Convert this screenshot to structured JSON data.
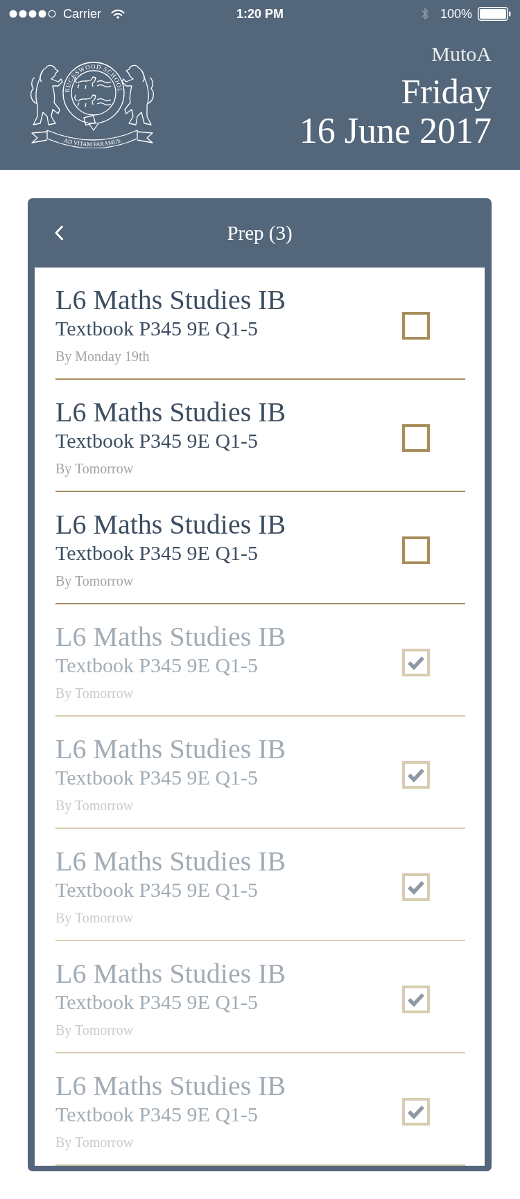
{
  "status_bar": {
    "carrier": "Carrier",
    "time": "1:20 PM",
    "battery": "100%"
  },
  "header": {
    "crest": {
      "ring_text": "BUCKSWOOD SCHOOL",
      "motto": "AD VITAM PARAMUS"
    },
    "user": "MutoA",
    "day": "Friday",
    "date": "16 June 2017"
  },
  "panel": {
    "title": "Prep (3)",
    "items": [
      {
        "subject": "L6 Maths Studies IB",
        "task": "Textbook P345 9E Q1-5",
        "due": "By Monday 19th",
        "checked": false
      },
      {
        "subject": "L6 Maths Studies IB",
        "task": "Textbook P345 9E Q1-5",
        "due": "By Tomorrow",
        "checked": false
      },
      {
        "subject": "L6 Maths Studies IB",
        "task": "Textbook P345 9E Q1-5",
        "due": "By Tomorrow",
        "checked": false
      },
      {
        "subject": "L6 Maths Studies IB",
        "task": "Textbook P345 9E Q1-5",
        "due": "By Tomorrow",
        "checked": true
      },
      {
        "subject": "L6 Maths Studies IB",
        "task": "Textbook P345 9E Q1-5",
        "due": "By Tomorrow",
        "checked": true
      },
      {
        "subject": "L6 Maths Studies IB",
        "task": "Textbook P345 9E Q1-5",
        "due": "By Tomorrow",
        "checked": true
      },
      {
        "subject": "L6 Maths Studies IB",
        "task": "Textbook P345 9E Q1-5",
        "due": "By Tomorrow",
        "checked": true
      },
      {
        "subject": "L6 Maths Studies IB",
        "task": "Textbook P345 9E Q1-5",
        "due": "By Tomorrow",
        "checked": true
      }
    ]
  }
}
